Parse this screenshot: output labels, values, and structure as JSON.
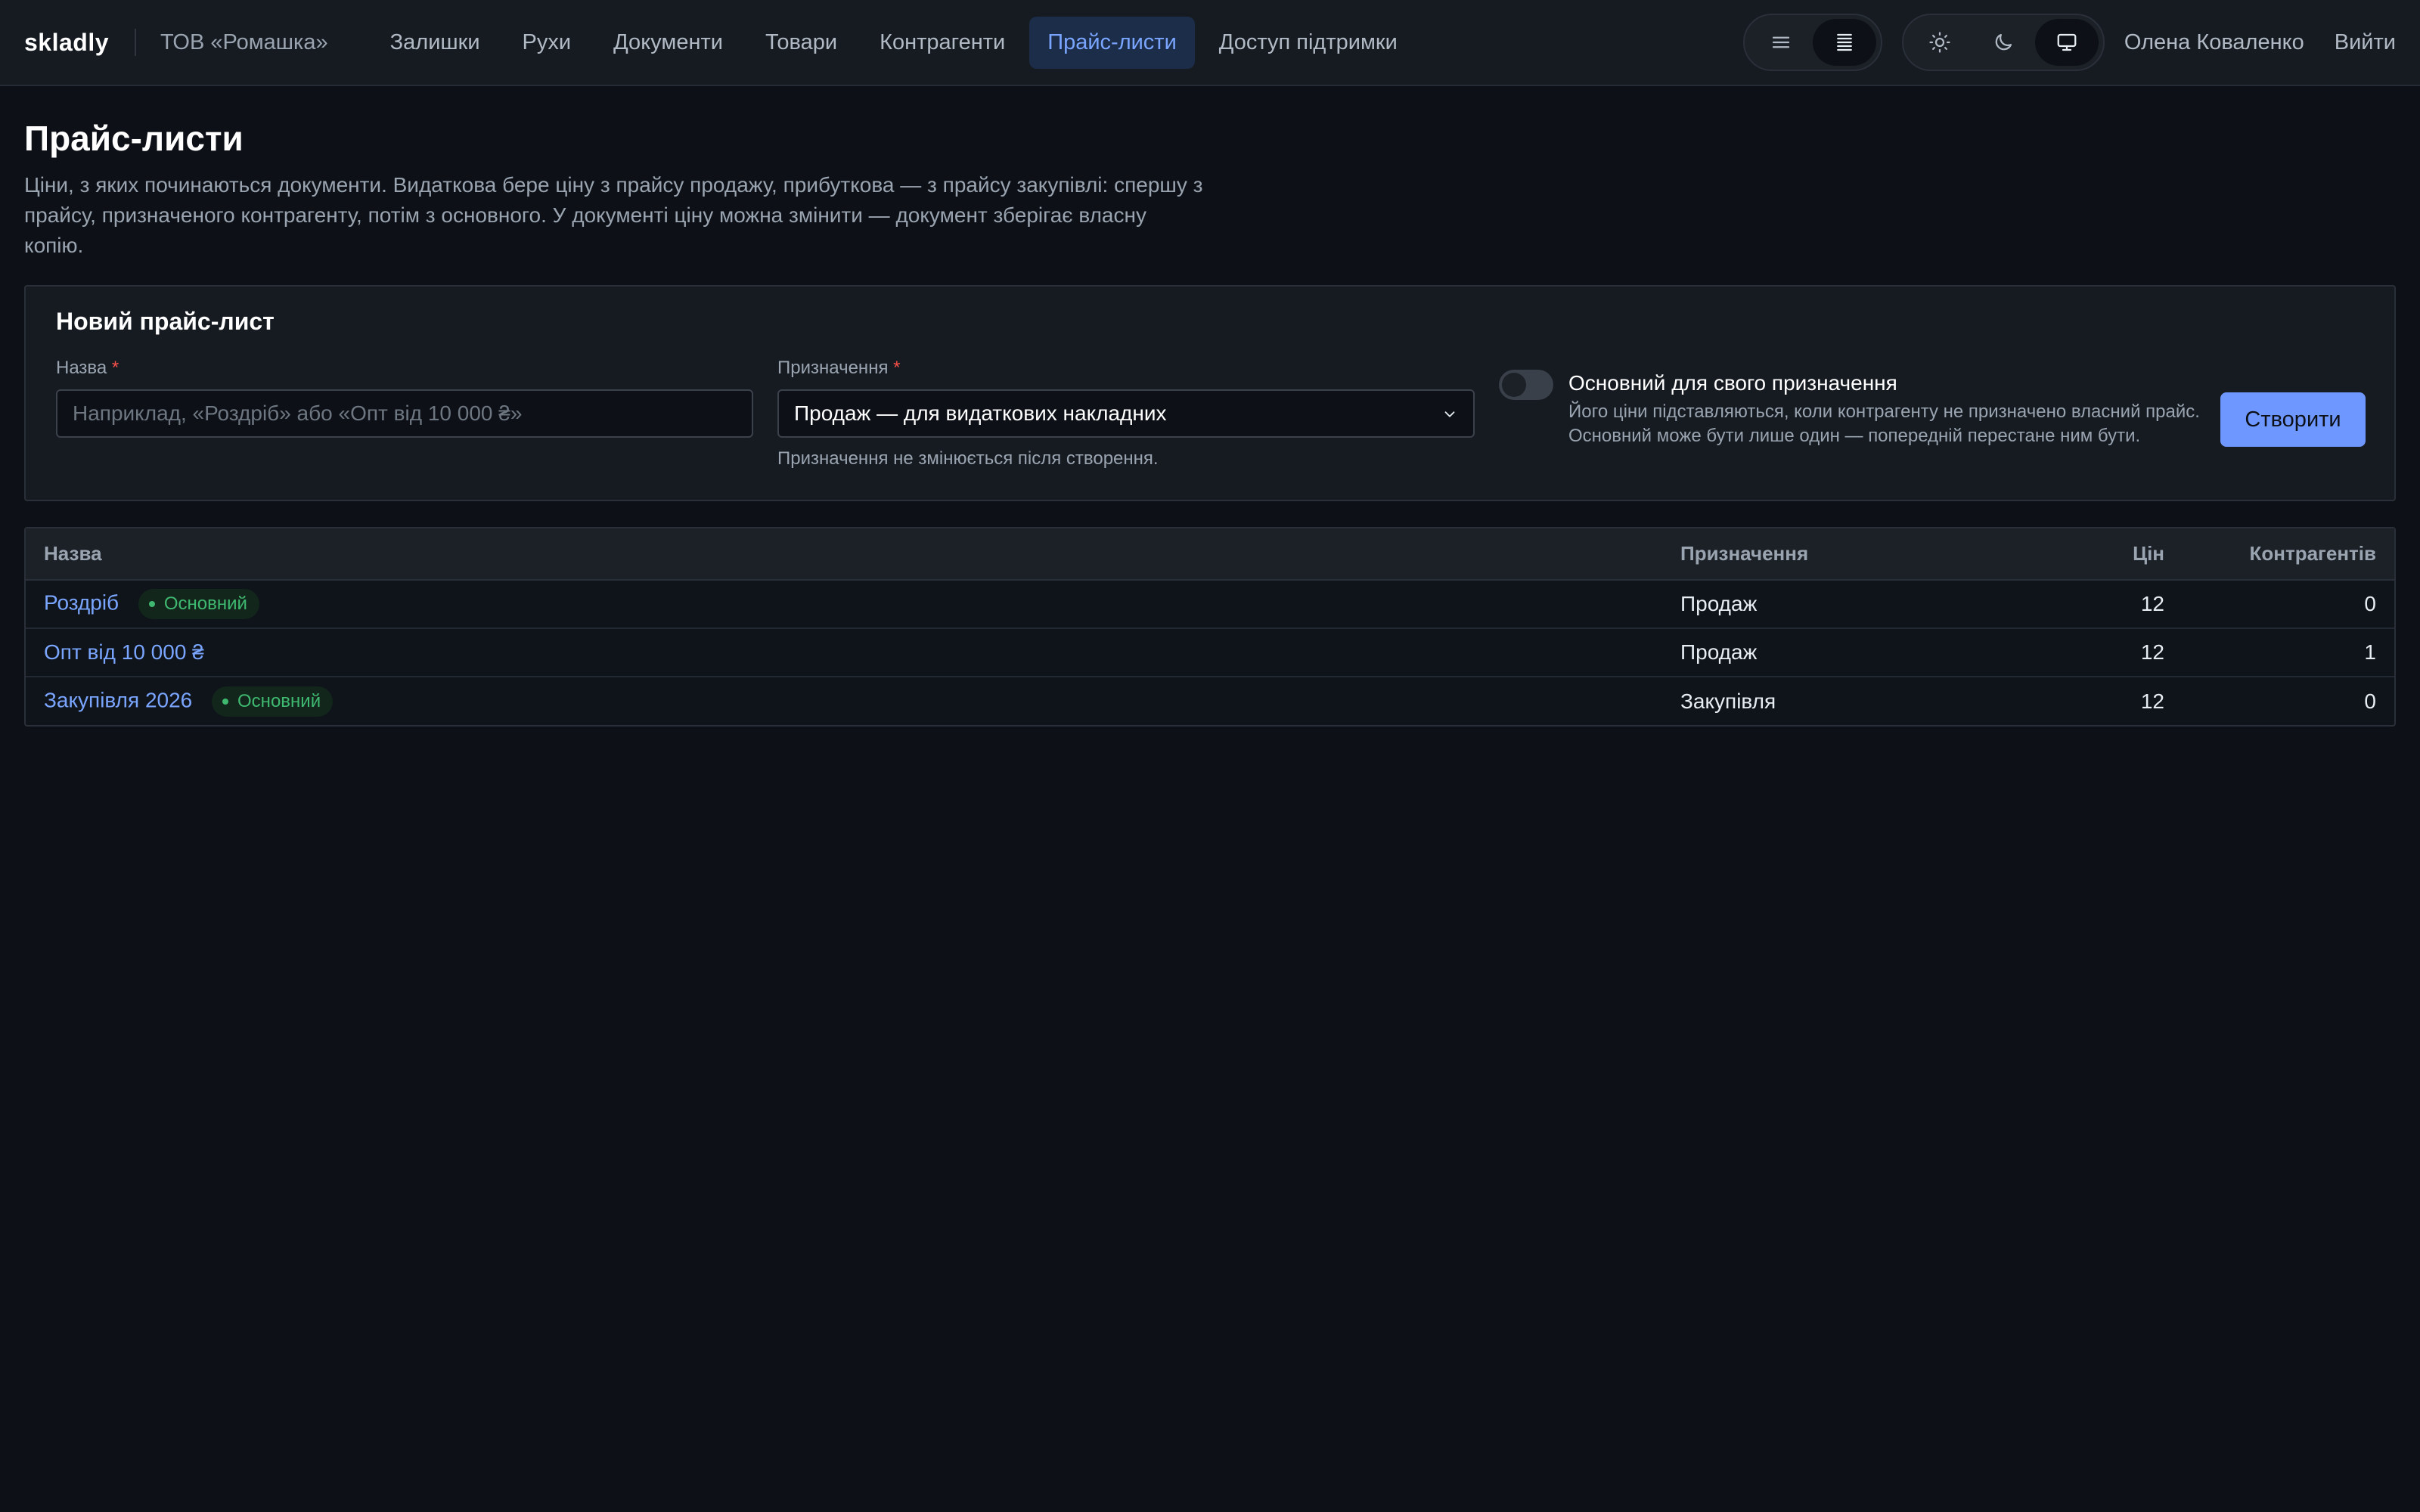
{
  "header": {
    "brand": "skladly",
    "org": "ТОВ «Ромашка»",
    "nav": [
      {
        "label": "Залишки"
      },
      {
        "label": "Рухи"
      },
      {
        "label": "Документи"
      },
      {
        "label": "Товари"
      },
      {
        "label": "Контрагенти"
      },
      {
        "label": "Прайс-листи",
        "active": true
      },
      {
        "label": "Доступ підтримки"
      }
    ],
    "density_toggle": [
      "list-icon",
      "list-dense-icon"
    ],
    "density_selected": "list-dense-icon",
    "theme_toggle": [
      "sun-icon",
      "moon-icon",
      "monitor-icon"
    ],
    "theme_selected": "monitor-icon",
    "user": "Олена Коваленко",
    "logout": "Вийти"
  },
  "page": {
    "title": "Прайс-листи",
    "description": "Ціни, з яких починаються документи. Видаткова бере ціну з прайсу продажу, прибуткова — з прайсу закупівлі: спершу з прайсу, призначеного контрагенту, потім з основного. У документі ціну можна змінити — документ зберігає власну копію."
  },
  "form": {
    "title": "Новий прайс-лист",
    "name_label": "Назва",
    "name_value": "",
    "name_placeholder": "Наприклад, «Роздріб» або «Опт від 10 000 ₴»",
    "purpose_label": "Призначення",
    "purpose_value": "Продаж — для видаткових накладних",
    "purpose_hint": "Призначення не змінюється після створення.",
    "required_mark": "*",
    "default_toggle_on": false,
    "default_title": "Основний для свого призначення",
    "default_desc": "Його ціни підставляються, коли контрагенту не призначено власний прайс. Основний може бути лише один — попередній перестане ним бути.",
    "create_label": "Створити"
  },
  "table": {
    "columns": {
      "name": "Назва",
      "purpose": "Призначення",
      "prices": "Цін",
      "counterparties": "Контрагентів"
    },
    "badge_label": "Основний",
    "rows": [
      {
        "name": "Роздріб",
        "is_default": true,
        "purpose": "Продаж",
        "prices": "12",
        "counterparties": "0"
      },
      {
        "name": "Опт від 10 000 ₴",
        "is_default": false,
        "purpose": "Продаж",
        "prices": "12",
        "counterparties": "1"
      },
      {
        "name": "Закупівля 2026",
        "is_default": true,
        "purpose": "Закупівля",
        "prices": "12",
        "counterparties": "0"
      }
    ]
  },
  "colors": {
    "background": "#0d1117",
    "accent": "#7aa5ff",
    "button": "#6e97ff",
    "success": "#3fb970",
    "required": "#f85149"
  }
}
